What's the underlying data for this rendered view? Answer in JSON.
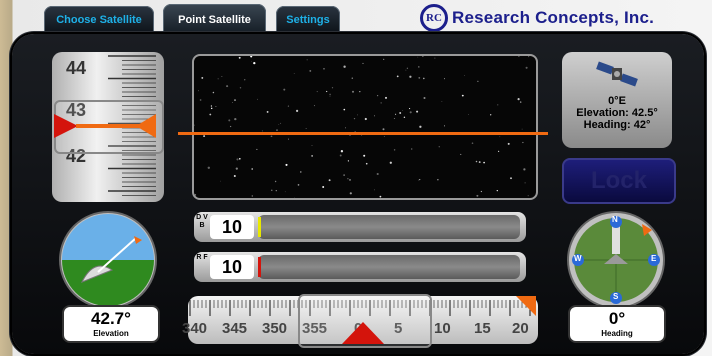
{
  "tabs": [
    {
      "label": "Choose Satellite"
    },
    {
      "label": "Point Satellite"
    },
    {
      "label": "Settings"
    }
  ],
  "brand": {
    "logo_text": "RC",
    "name": "Research Concepts, Inc."
  },
  "elevation_tape": {
    "labels": [
      "44",
      "43",
      "42"
    ]
  },
  "satellite_info": {
    "position": "0°E",
    "elevation": "Elevation: 42.5°",
    "heading": "Heading: 42°"
  },
  "lock_button": {
    "label": "Lock"
  },
  "signal": {
    "dvb": {
      "tag": "D V B",
      "value": "10"
    },
    "rf": {
      "tag": "R F",
      "value": "10"
    }
  },
  "heading_tape": {
    "labels": [
      "340",
      "345",
      "350",
      "355",
      "0",
      "5",
      "10",
      "15",
      "20"
    ]
  },
  "elevation_readout": {
    "value": "42.7°",
    "label": "Elevation"
  },
  "heading_readout": {
    "value": "0°",
    "label": "Heading"
  },
  "compass": {
    "labels": {
      "n": "N",
      "e": "E",
      "s": "S",
      "w": "W"
    }
  },
  "colors": {
    "accent": "#f06a12",
    "tab_text": "#1eb1e8",
    "brand": "#1c1f8c",
    "lock": "#1e1e7a"
  }
}
